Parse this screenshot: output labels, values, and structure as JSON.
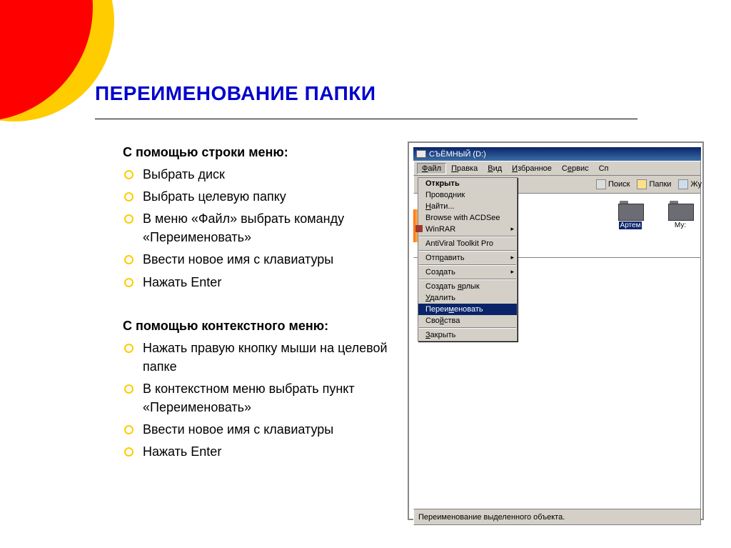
{
  "title": "ПЕРЕИМЕНОВАНИЕ ПАПКИ",
  "section1": {
    "heading": "С помощью строки меню:",
    "items": [
      "Выбрать диск",
      "Выбрать целевую папку",
      "В меню «Файл» выбрать команду «Переименовать»",
      "Ввести новое имя с клавиатуры",
      "Нажать Enter"
    ]
  },
  "section2": {
    "heading": "С помощью контекстного меню:",
    "items": [
      "Нажать правую кнопку мыши на целевой папке",
      "В контекстном меню выбрать пункт «Переименовать»",
      "Ввести новое имя с клавиатуры",
      "Нажать Enter"
    ]
  },
  "window": {
    "title": "СЪЁМНЫЙ (D:)",
    "menubar": [
      "Файл",
      "Правка",
      "Вид",
      "Избранное",
      "Сервис",
      "Сп"
    ],
    "toolbar": {
      "search": "Поиск",
      "folders": "Папки",
      "journal": "Жу"
    },
    "menu": {
      "open": "Открыть",
      "explorer": "Проводник",
      "find": "Найти...",
      "browse_acdsee": "Browse with ACDSee",
      "winrar": "WinRAR",
      "antiviral": "AntiViral Toolkit Pro",
      "send": "Отправить",
      "create": "Создать",
      "shortcut": "Создать ярлык",
      "delete": "Удалить",
      "rename": "Переименовать",
      "properties": "Свойства",
      "close": "Закрыть"
    },
    "folders": {
      "artem": "Артем",
      "muz": "Му:"
    },
    "statusbar": "Переименование выделенного объекта."
  }
}
